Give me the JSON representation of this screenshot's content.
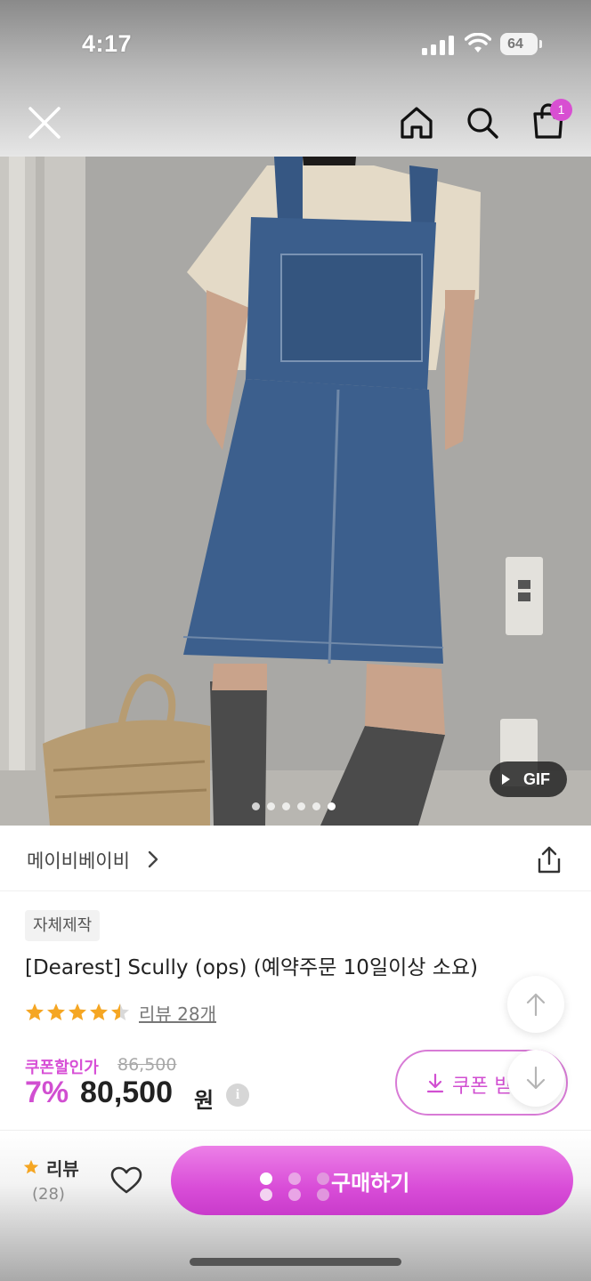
{
  "status_bar": {
    "time": "4:17",
    "battery": "64"
  },
  "top_nav": {
    "cart_count": "1"
  },
  "gallery": {
    "gif_label": "GIF",
    "image_count": 6,
    "active_index": 5
  },
  "brand": {
    "name": "메이비베이비"
  },
  "product": {
    "tag": "자체제작",
    "title": "[Dearest] Scully (ops) (예약주문 10일이상 소요)",
    "rating": 4.5,
    "review_link": "리뷰 28개",
    "coupon_label": "쿠폰할인가",
    "original_price": "86,500",
    "discount": "7%",
    "price": "80,500",
    "currency": "원",
    "info_glyph": "i",
    "coupon_button": "쿠폰 받"
  },
  "bottom_bar": {
    "review_label": "리뷰",
    "review_count": "(28)",
    "buy_label": "구매하기"
  },
  "colors": {
    "accent": "#d14fd1",
    "accent_light": "#ec80e7",
    "star": "#f5a623"
  },
  "icons": [
    "close-icon",
    "home-icon",
    "search-icon",
    "cart-icon",
    "share-icon",
    "chevron-right-icon",
    "info-icon",
    "download-icon",
    "arrow-up-icon",
    "arrow-down-icon",
    "star-icon",
    "heart-icon",
    "play-icon"
  ]
}
